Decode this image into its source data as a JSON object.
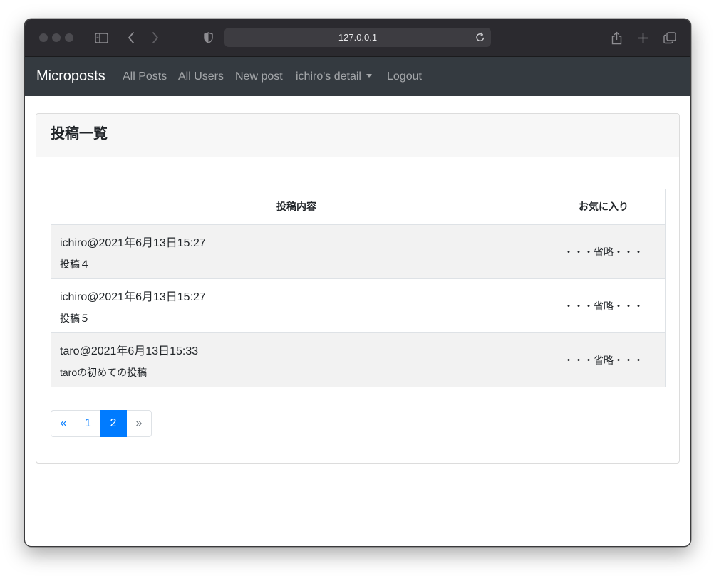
{
  "browser": {
    "url": "127.0.0.1"
  },
  "navbar": {
    "brand": "Microposts",
    "links": [
      {
        "label": "All Posts"
      },
      {
        "label": "All Users"
      },
      {
        "label": "New post"
      },
      {
        "label": "ichiro's detail"
      },
      {
        "label": "Logout"
      }
    ]
  },
  "page": {
    "title": "投稿一覧",
    "table": {
      "headers": [
        "投稿内容",
        "お気に入り"
      ],
      "rows": [
        {
          "meta": "ichiro@2021年6月13日15:27",
          "content": "投稿４",
          "favorite": "・・・省略・・・"
        },
        {
          "meta": "ichiro@2021年6月13日15:27",
          "content": "投稿５",
          "favorite": "・・・省略・・・"
        },
        {
          "meta": "taro@2021年6月13日15:33",
          "content": "taroの初めての投稿",
          "favorite": "・・・省略・・・"
        }
      ]
    },
    "pagination": {
      "prev": "«",
      "pages": [
        "1",
        "2"
      ],
      "current": "2",
      "next": "»"
    }
  },
  "colors": {
    "navbar_bg": "#343a40",
    "link_primary": "#007bff",
    "toolbar_bg": "#2b2a2f"
  },
  "icons": [
    "window-control-dot",
    "sidebar-icon",
    "back-icon",
    "forward-icon",
    "privacy-shield-icon",
    "reload-icon",
    "share-icon",
    "new-tab-icon",
    "tabs-overview-icon",
    "dropdown-caret-icon"
  ]
}
